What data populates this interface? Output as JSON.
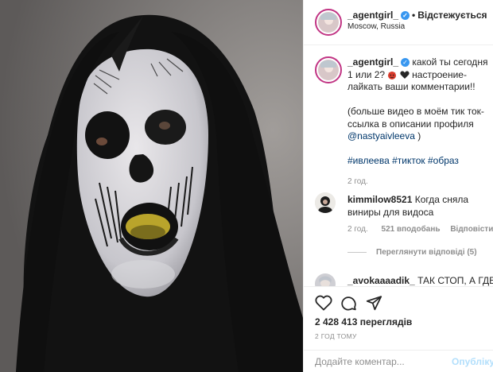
{
  "post": {
    "author": "_agentgirl_",
    "follow_status": "Відстежується",
    "separator": "•",
    "location": "Moscow, Russia"
  },
  "caption": {
    "author": "_agentgirl_",
    "text_1": "какой ты сегодня 1 или 2?",
    "text_2": "настроение-лайкать ваши комментарии!!",
    "text_3": "(больше видео в моём тик ток- ссылка в описании профиля",
    "mention": "@nastyaivleeva",
    "text_4": ")",
    "tag_1": "#ивлеева",
    "tag_2": "#тикток",
    "tag_3": "#образ",
    "time": "2 год."
  },
  "comments": [
    {
      "author": "kimmilow8521",
      "text": "Когда сняла виниры для видоса",
      "time": "2 год.",
      "likes": "521 вподобань",
      "reply": "Відповісти",
      "view_replies": "Переглянути відповіді (5)"
    },
    {
      "author": "_avokaaaadik_",
      "text": "ТАК СТОП, А ГДЕ"
    }
  ],
  "stats": {
    "views": "2 428 413 переглядів",
    "posted": "2 ГОД ТОМУ"
  },
  "add_comment": {
    "placeholder": "Додайте коментар...",
    "publish": "Опублікуват"
  },
  "colors": {
    "link": "#00376b",
    "verified": "#3897f0",
    "publish_disabled": "#b2dffc",
    "muted": "#8e8e8e"
  }
}
